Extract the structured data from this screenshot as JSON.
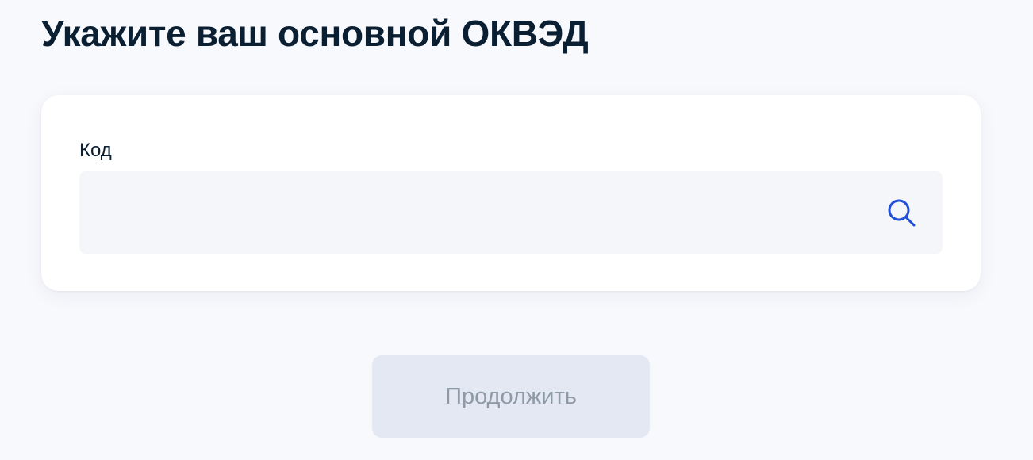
{
  "page": {
    "title": "Укажите ваш основной ОКВЭД"
  },
  "form": {
    "code_label": "Код",
    "code_value": "",
    "search_icon": "search-icon",
    "search_icon_color": "#1d4fd8"
  },
  "actions": {
    "continue_label": "Продолжить",
    "continue_disabled": true
  },
  "colors": {
    "background": "#f8f9fd",
    "text": "#0b1f33",
    "button_disabled_bg": "#e4e8f2",
    "button_disabled_text": "#8f9aa8"
  }
}
